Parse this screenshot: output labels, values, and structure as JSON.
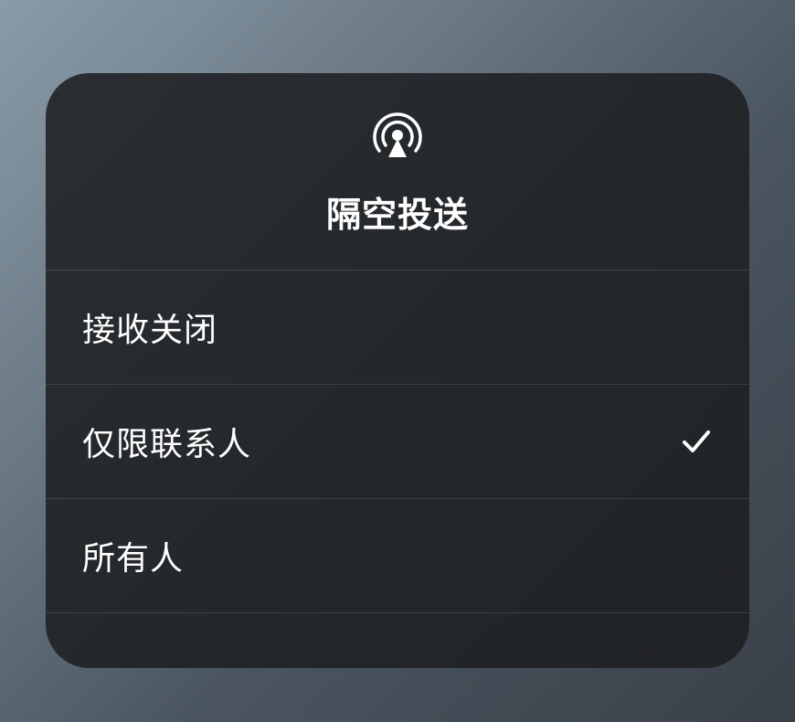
{
  "header": {
    "title": "隔空投送",
    "icon": "airdrop-icon"
  },
  "options": [
    {
      "label": "接收关闭",
      "selected": false
    },
    {
      "label": "仅限联系人",
      "selected": true
    },
    {
      "label": "所有人",
      "selected": false
    }
  ]
}
